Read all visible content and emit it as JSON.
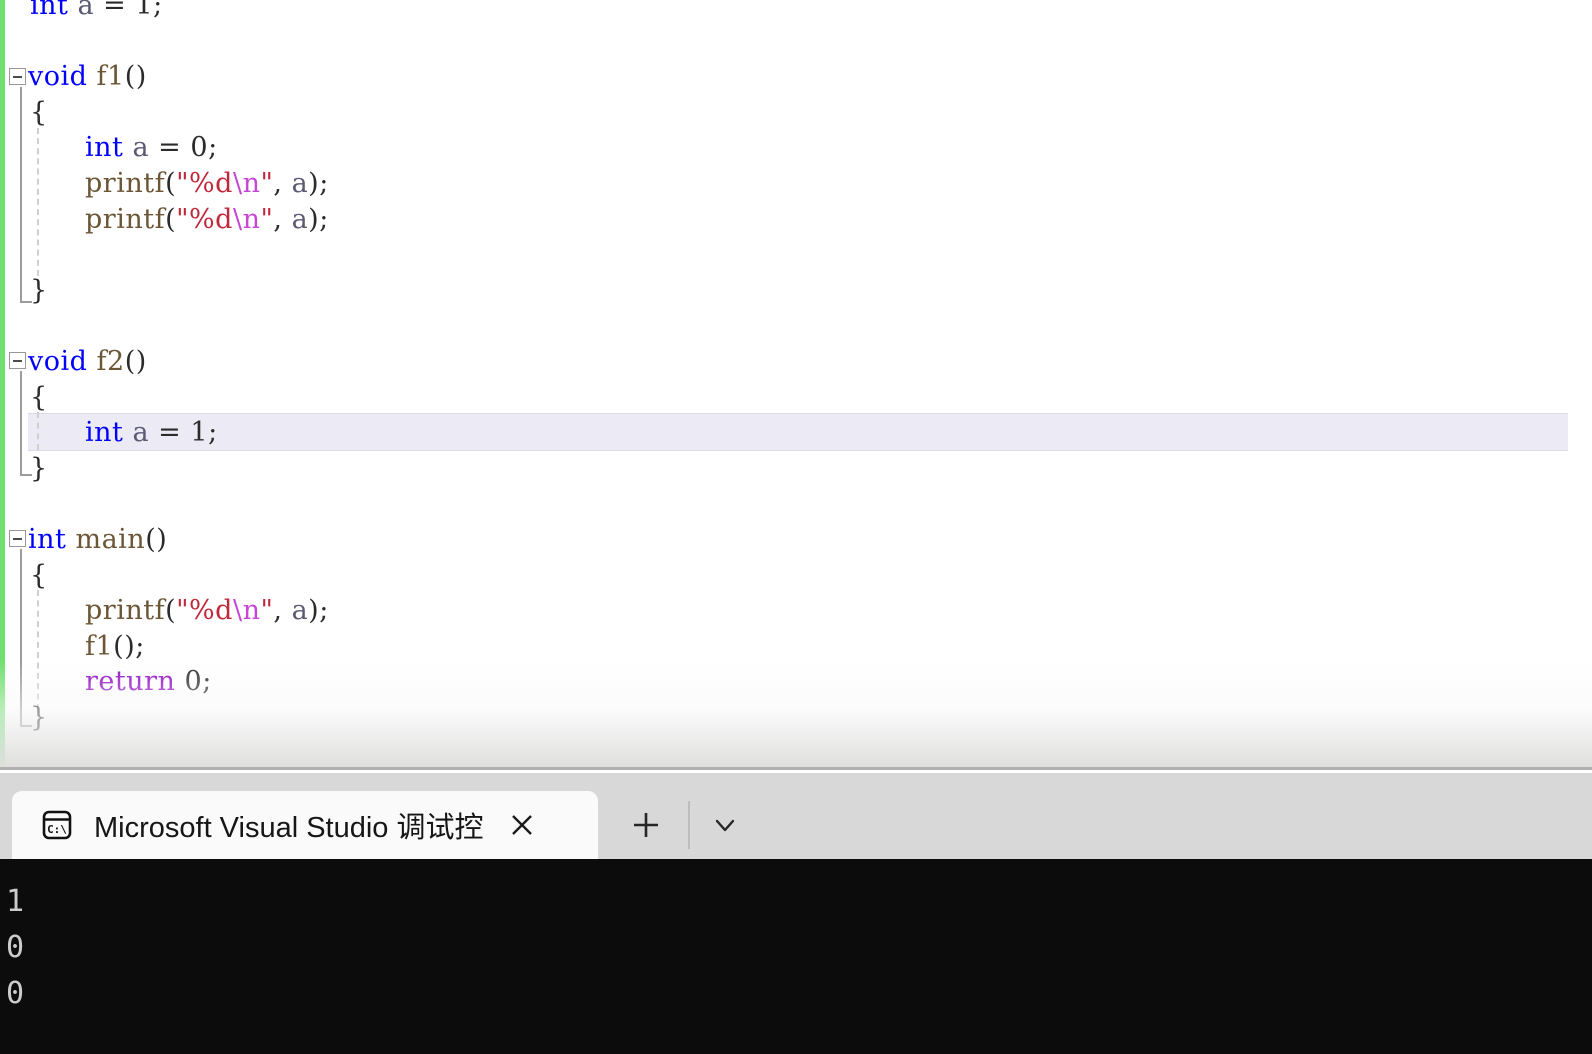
{
  "editor": {
    "language": "c",
    "change_bar_color": "#6ee06e",
    "current_line_highlight_color": "#eceaf5",
    "background": "#ffffff",
    "lines": [
      {
        "indent": 1,
        "tokens": [
          {
            "t": "int",
            "c": "kw"
          },
          {
            "t": " ",
            "c": "punc"
          },
          {
            "t": "a",
            "c": "var"
          },
          {
            "t": " = ",
            "c": "punc"
          },
          {
            "t": "1",
            "c": "num"
          },
          {
            "t": ";",
            "c": "punc"
          }
        ]
      },
      {
        "indent": 0,
        "tokens": []
      },
      {
        "indent": 0,
        "tokens": [
          {
            "t": "void",
            "c": "kw"
          },
          {
            "t": " ",
            "c": "punc"
          },
          {
            "t": "f1",
            "c": "id"
          },
          {
            "t": "()",
            "c": "punc"
          }
        ]
      },
      {
        "indent": 1,
        "tokens": [
          {
            "t": "{",
            "c": "punc"
          }
        ]
      },
      {
        "indent": 2,
        "tokens": [
          {
            "t": "int",
            "c": "kw"
          },
          {
            "t": " ",
            "c": "punc"
          },
          {
            "t": "a",
            "c": "var"
          },
          {
            "t": " = ",
            "c": "punc"
          },
          {
            "t": "0",
            "c": "num"
          },
          {
            "t": ";",
            "c": "punc"
          }
        ]
      },
      {
        "indent": 2,
        "tokens": [
          {
            "t": "printf",
            "c": "id"
          },
          {
            "t": "(",
            "c": "punc"
          },
          {
            "t": "\"%d",
            "c": "str"
          },
          {
            "t": "\\n",
            "c": "esc"
          },
          {
            "t": "\"",
            "c": "str"
          },
          {
            "t": ", ",
            "c": "punc"
          },
          {
            "t": "a",
            "c": "var"
          },
          {
            "t": ");",
            "c": "punc"
          }
        ]
      },
      {
        "indent": 2,
        "tokens": [
          {
            "t": "printf",
            "c": "id"
          },
          {
            "t": "(",
            "c": "punc"
          },
          {
            "t": "\"%d",
            "c": "str"
          },
          {
            "t": "\\n",
            "c": "esc"
          },
          {
            "t": "\"",
            "c": "str"
          },
          {
            "t": ", ",
            "c": "punc"
          },
          {
            "t": "a",
            "c": "var"
          },
          {
            "t": ");",
            "c": "punc"
          }
        ]
      },
      {
        "indent": 0,
        "tokens": []
      },
      {
        "indent": 1,
        "tokens": [
          {
            "t": "}",
            "c": "punc"
          }
        ]
      },
      {
        "indent": 0,
        "tokens": []
      },
      {
        "indent": 0,
        "tokens": [
          {
            "t": "void",
            "c": "kw"
          },
          {
            "t": " ",
            "c": "punc"
          },
          {
            "t": "f2",
            "c": "id"
          },
          {
            "t": "()",
            "c": "punc"
          }
        ]
      },
      {
        "indent": 1,
        "tokens": [
          {
            "t": "{",
            "c": "punc"
          }
        ]
      },
      {
        "indent": 2,
        "tokens": [
          {
            "t": "int",
            "c": "kw"
          },
          {
            "t": " ",
            "c": "punc"
          },
          {
            "t": "a",
            "c": "var"
          },
          {
            "t": " = ",
            "c": "punc"
          },
          {
            "t": "1",
            "c": "num"
          },
          {
            "t": ";",
            "c": "punc"
          }
        ],
        "current": true
      },
      {
        "indent": 1,
        "tokens": [
          {
            "t": "}",
            "c": "punc"
          }
        ]
      },
      {
        "indent": 0,
        "tokens": []
      },
      {
        "indent": 0,
        "tokens": [
          {
            "t": "int",
            "c": "kw"
          },
          {
            "t": " ",
            "c": "punc"
          },
          {
            "t": "main",
            "c": "id"
          },
          {
            "t": "()",
            "c": "punc"
          }
        ]
      },
      {
        "indent": 1,
        "tokens": [
          {
            "t": "{",
            "c": "punc"
          }
        ]
      },
      {
        "indent": 2,
        "tokens": [
          {
            "t": "printf",
            "c": "id"
          },
          {
            "t": "(",
            "c": "punc"
          },
          {
            "t": "\"%d",
            "c": "str"
          },
          {
            "t": "\\n",
            "c": "esc"
          },
          {
            "t": "\"",
            "c": "str"
          },
          {
            "t": ", ",
            "c": "punc"
          },
          {
            "t": "a",
            "c": "var"
          },
          {
            "t": ");",
            "c": "punc"
          }
        ]
      },
      {
        "indent": 2,
        "tokens": [
          {
            "t": "f1",
            "c": "id"
          },
          {
            "t": "();",
            "c": "punc"
          }
        ]
      },
      {
        "indent": 2,
        "tokens": [
          {
            "t": "return",
            "c": "kw2"
          },
          {
            "t": " ",
            "c": "punc"
          },
          {
            "t": "0",
            "c": "num"
          },
          {
            "t": ";",
            "c": "punc"
          }
        ]
      },
      {
        "indent": 1,
        "tokens": [
          {
            "t": "}",
            "c": "punc"
          }
        ]
      }
    ],
    "plain_text": "    int a = 1;\n\nvoid f1()\n{\n    int a = 0;\n    printf(\"%d\\n\", a);\n    printf(\"%d\\n\", a);\n\n}\n\nvoid f2()\n{\n    int a = 1;\n}\n\nint main()\n{\n    printf(\"%d\\n\", a);\n    f1();\n    return 0;\n}"
  },
  "terminal": {
    "tab": {
      "icon": "console-cmd-icon",
      "title": "Microsoft Visual Studio 调试控",
      "close_label": "✕",
      "active": true
    },
    "new_tab_label": "+",
    "dropdown_label": "⌄",
    "tabbar_background": "#d8d8d8",
    "active_tab_background": "#fafafa",
    "console": {
      "background": "#0c0c0c",
      "text_color": "#cccccc",
      "output": [
        "1",
        "0",
        "0"
      ]
    }
  }
}
